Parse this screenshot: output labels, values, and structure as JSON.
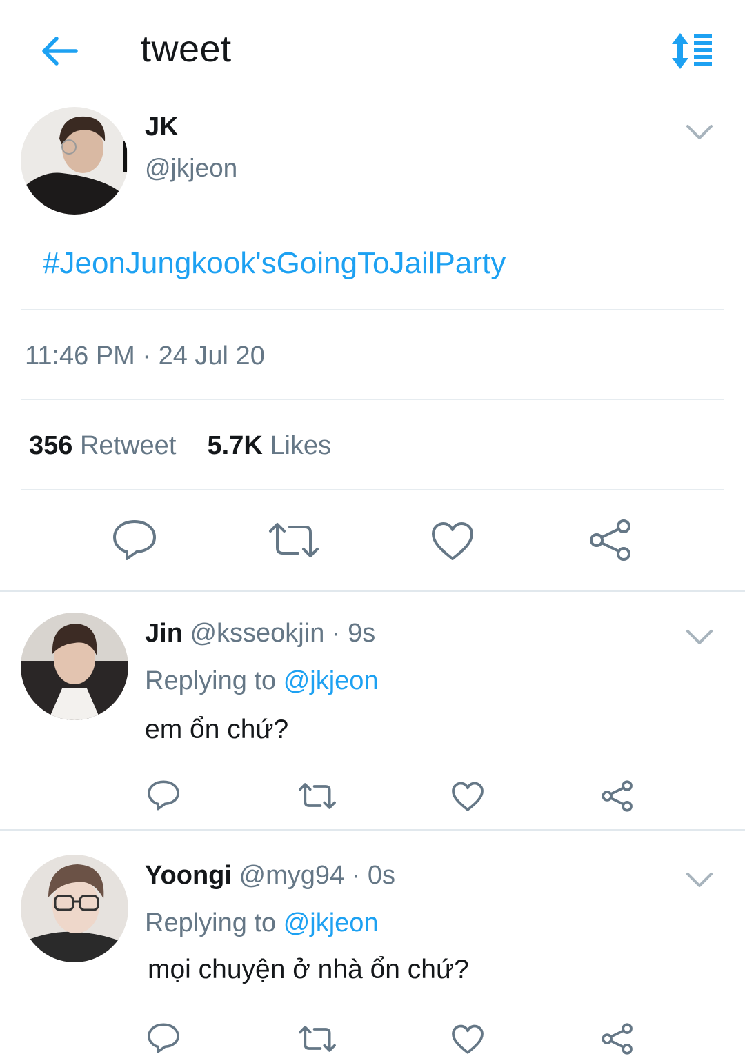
{
  "header": {
    "title": "tweet",
    "back_icon": "arrow-left-icon",
    "sort_icon": "sort-list-icon",
    "accent_color": "#1da1f2"
  },
  "tweet": {
    "author_name": "JK",
    "author_handle": "@jkjeon",
    "text": "#JeonJungkook'sGoingToJailParty",
    "timestamp": "11:46 PM · 24 Jul 20",
    "retweet_count": "356",
    "retweet_label": "Retweet",
    "likes_count": "5.7K",
    "likes_label": "Likes",
    "actions": [
      "reply-icon",
      "retweet-icon",
      "like-icon",
      "share-icon"
    ]
  },
  "replies": [
    {
      "name": "Jin",
      "handle": "@ksseokjin",
      "time": "· 9s",
      "replying_prefix": "Replying to",
      "replying_to": "@jkjeon",
      "text": "em ổn chứ?"
    },
    {
      "name": "Yoongi",
      "handle": "@myg94",
      "time": "· 0s",
      "replying_prefix": "Replying to",
      "replying_to": "@jkjeon",
      "text": "mọi chuyện ở nhà ổn chứ?"
    }
  ]
}
